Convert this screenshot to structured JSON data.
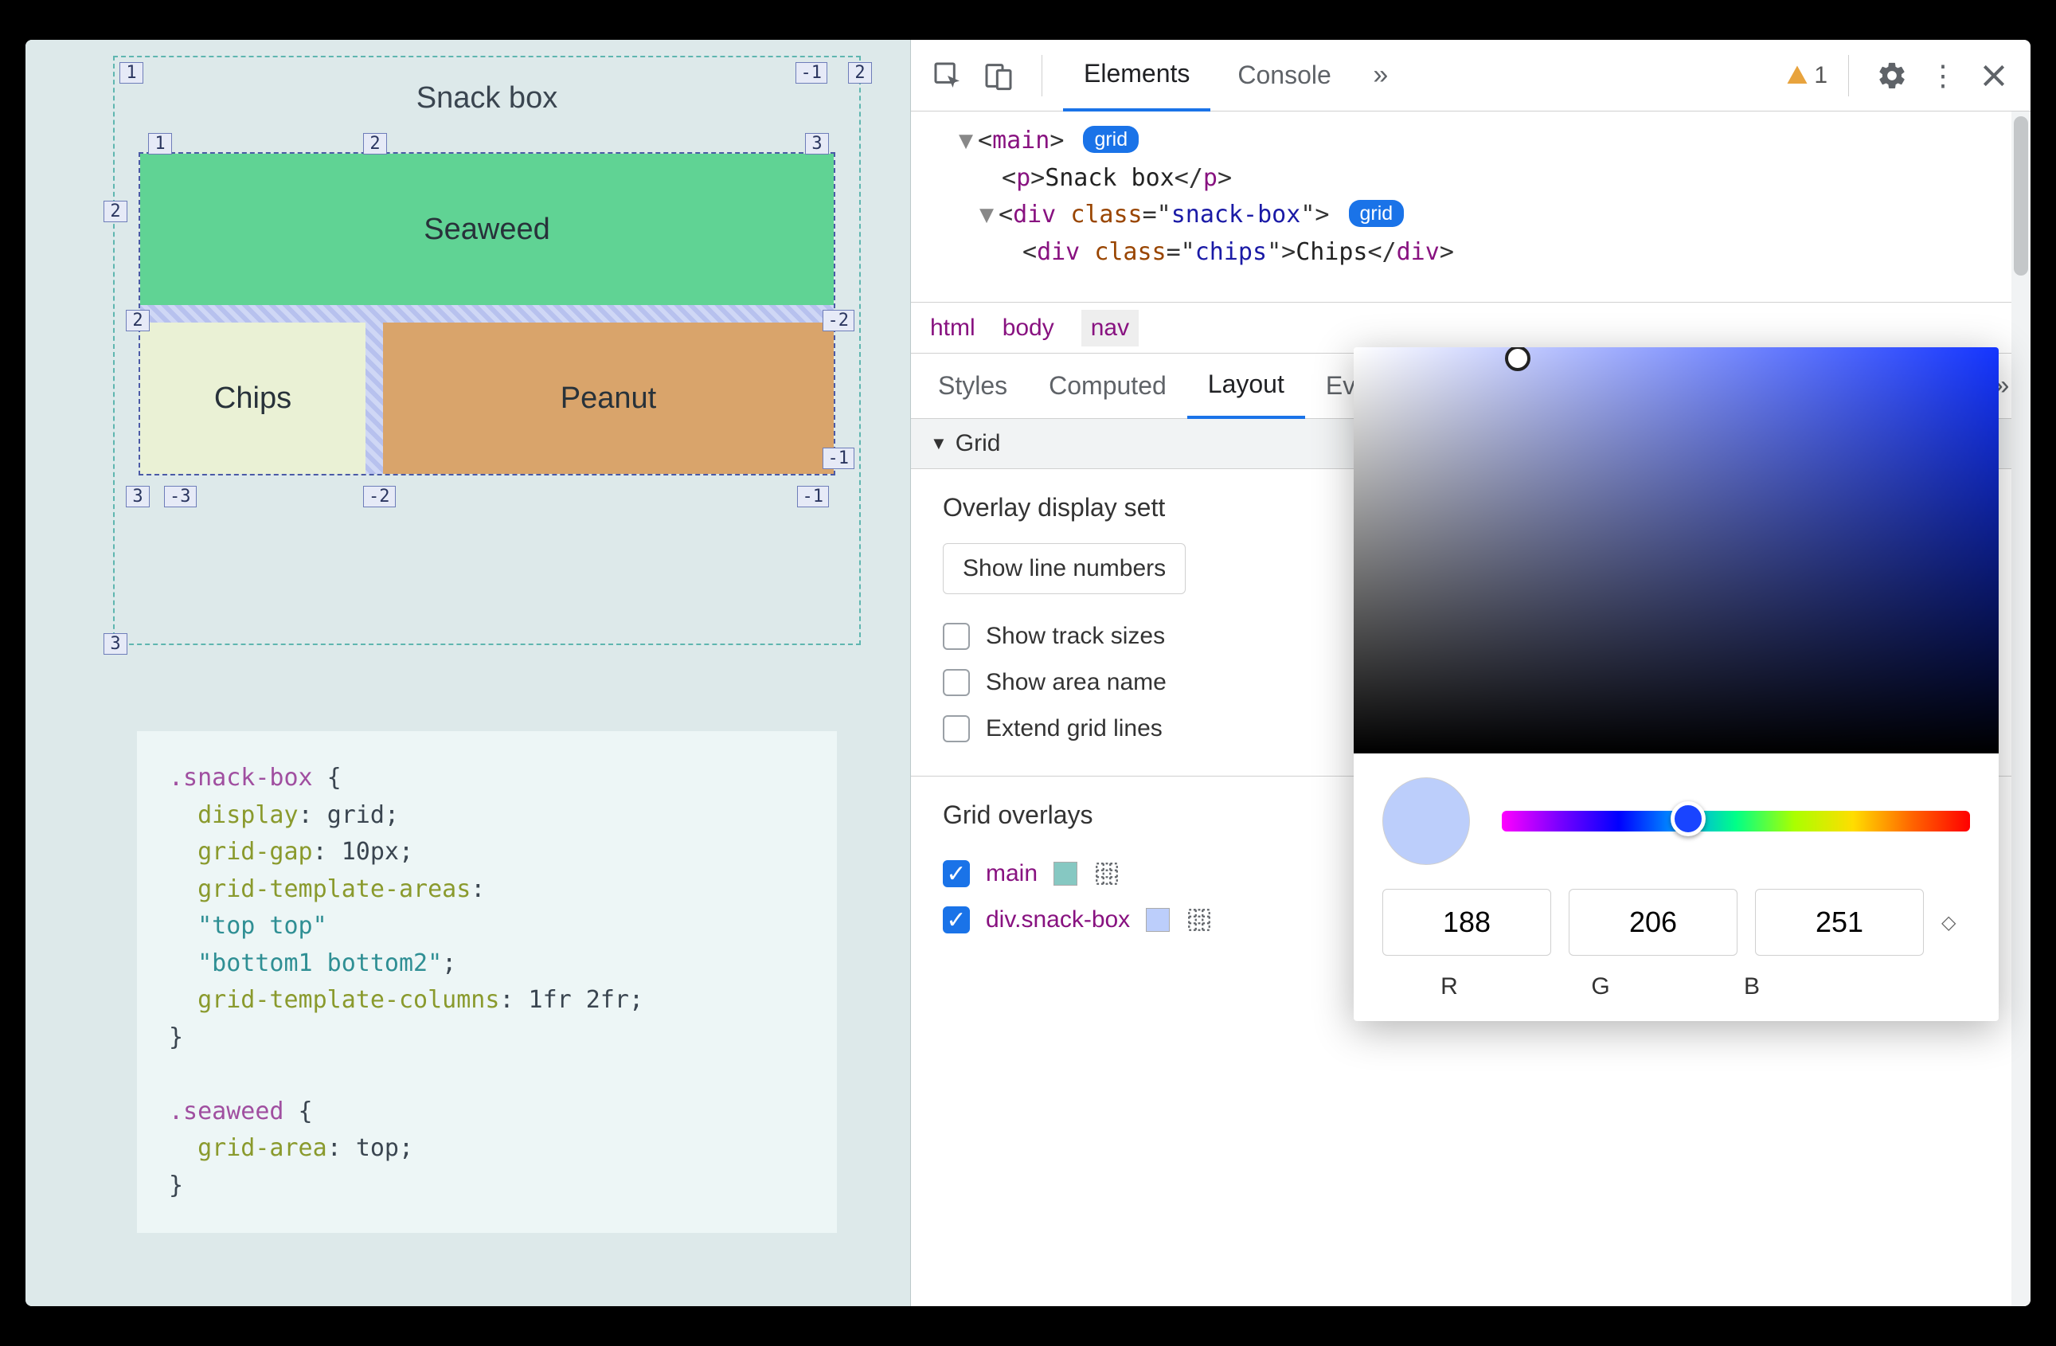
{
  "preview": {
    "title": "Snack box",
    "cells": {
      "seaweed": "Seaweed",
      "chips": "Chips",
      "peanut": "Peanut"
    },
    "outerLines": {
      "tl": "1",
      "tr_left": "-1",
      "tr_right": "2",
      "l2": "2",
      "l3": "3"
    },
    "innerLines": {
      "top": [
        "1",
        "2",
        "3"
      ],
      "leftMid": "2",
      "rightMid": "-2",
      "botLeft": "3",
      "botLeft2": "-3",
      "botMid": "-2",
      "botRight": "-1",
      "midRight": "-1"
    }
  },
  "code": {
    "r1_sel": ".snack-box",
    "r2_prop": "display",
    "r2_val": "grid",
    "r3_prop": "grid-gap",
    "r3_val": "10px",
    "r4_prop": "grid-template-areas",
    "r5_str": "\"top top\"",
    "r6_str": "\"bottom1 bottom2\"",
    "r7_prop": "grid-template-columns",
    "r7_val": "1fr 2fr",
    "r9_sel": ".seaweed",
    "r10_prop": "grid-area",
    "r10_val": "top"
  },
  "toolbar": {
    "tabs": {
      "elements": "Elements",
      "console": "Console"
    },
    "warnCount": "1"
  },
  "dom": {
    "main_open": "main",
    "grid_badge": "grid",
    "p_text": "Snack box",
    "div_class_snack": "snack-box",
    "div_class_chips": "chips",
    "chips_text": "Chips"
  },
  "breadcrumb": {
    "a": "html",
    "b": "body",
    "c": "nav"
  },
  "subtabs": {
    "styles": "Styles",
    "computed": "Computed",
    "layout": "Layout",
    "events": "Event Listeners"
  },
  "grid_section": {
    "head": "Grid",
    "overlayTitle": "Overlay display sett",
    "dropdown": "Show line numbers",
    "chk_track": "Show track sizes",
    "chk_area": "Show area name",
    "chk_extend": "Extend grid lines",
    "overlaysTitle": "Grid overlays",
    "ov1": "main",
    "ov2": "div.snack-box"
  },
  "picker": {
    "r": "188",
    "g": "206",
    "b": "251",
    "R": "R",
    "G": "G",
    "B": "B"
  }
}
